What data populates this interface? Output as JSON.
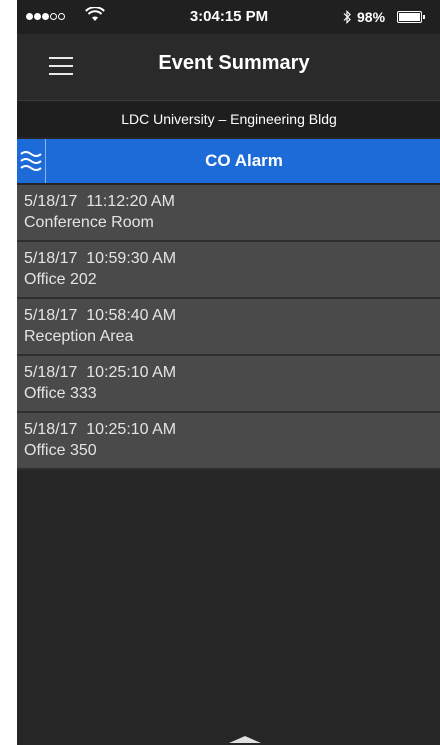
{
  "status_bar": {
    "signal_full": 3,
    "signal_empty": 2,
    "time": "3:04:15 PM",
    "battery": "98%",
    "battery_level": 0.98,
    "wifi_icon": "wifi-icon",
    "bluetooth_icon": "bluetooth-icon"
  },
  "nav": {
    "title": "Event Summary",
    "menu_icon": "hamburger-menu-icon"
  },
  "location": "LDC University  – Engineering  Bldg",
  "alarm": {
    "title": "CO Alarm",
    "icon": "waves-icon",
    "accent_color": "#1d6ad9"
  },
  "events": [
    {
      "time": "5/18/17  11:12:20 AM",
      "location": "Conference Room"
    },
    {
      "time": "5/18/17  10:59:30 AM",
      "location": "Office 202"
    },
    {
      "time": "5/18/17  10:58:40 AM",
      "location": "Reception Area"
    },
    {
      "time": "5/18/17  10:25:10 AM",
      "location": "Office 333"
    },
    {
      "time": "5/18/17  10:25:10 AM",
      "location": "Office 350"
    }
  ],
  "pull_handle_icon": "chevron-up-icon"
}
